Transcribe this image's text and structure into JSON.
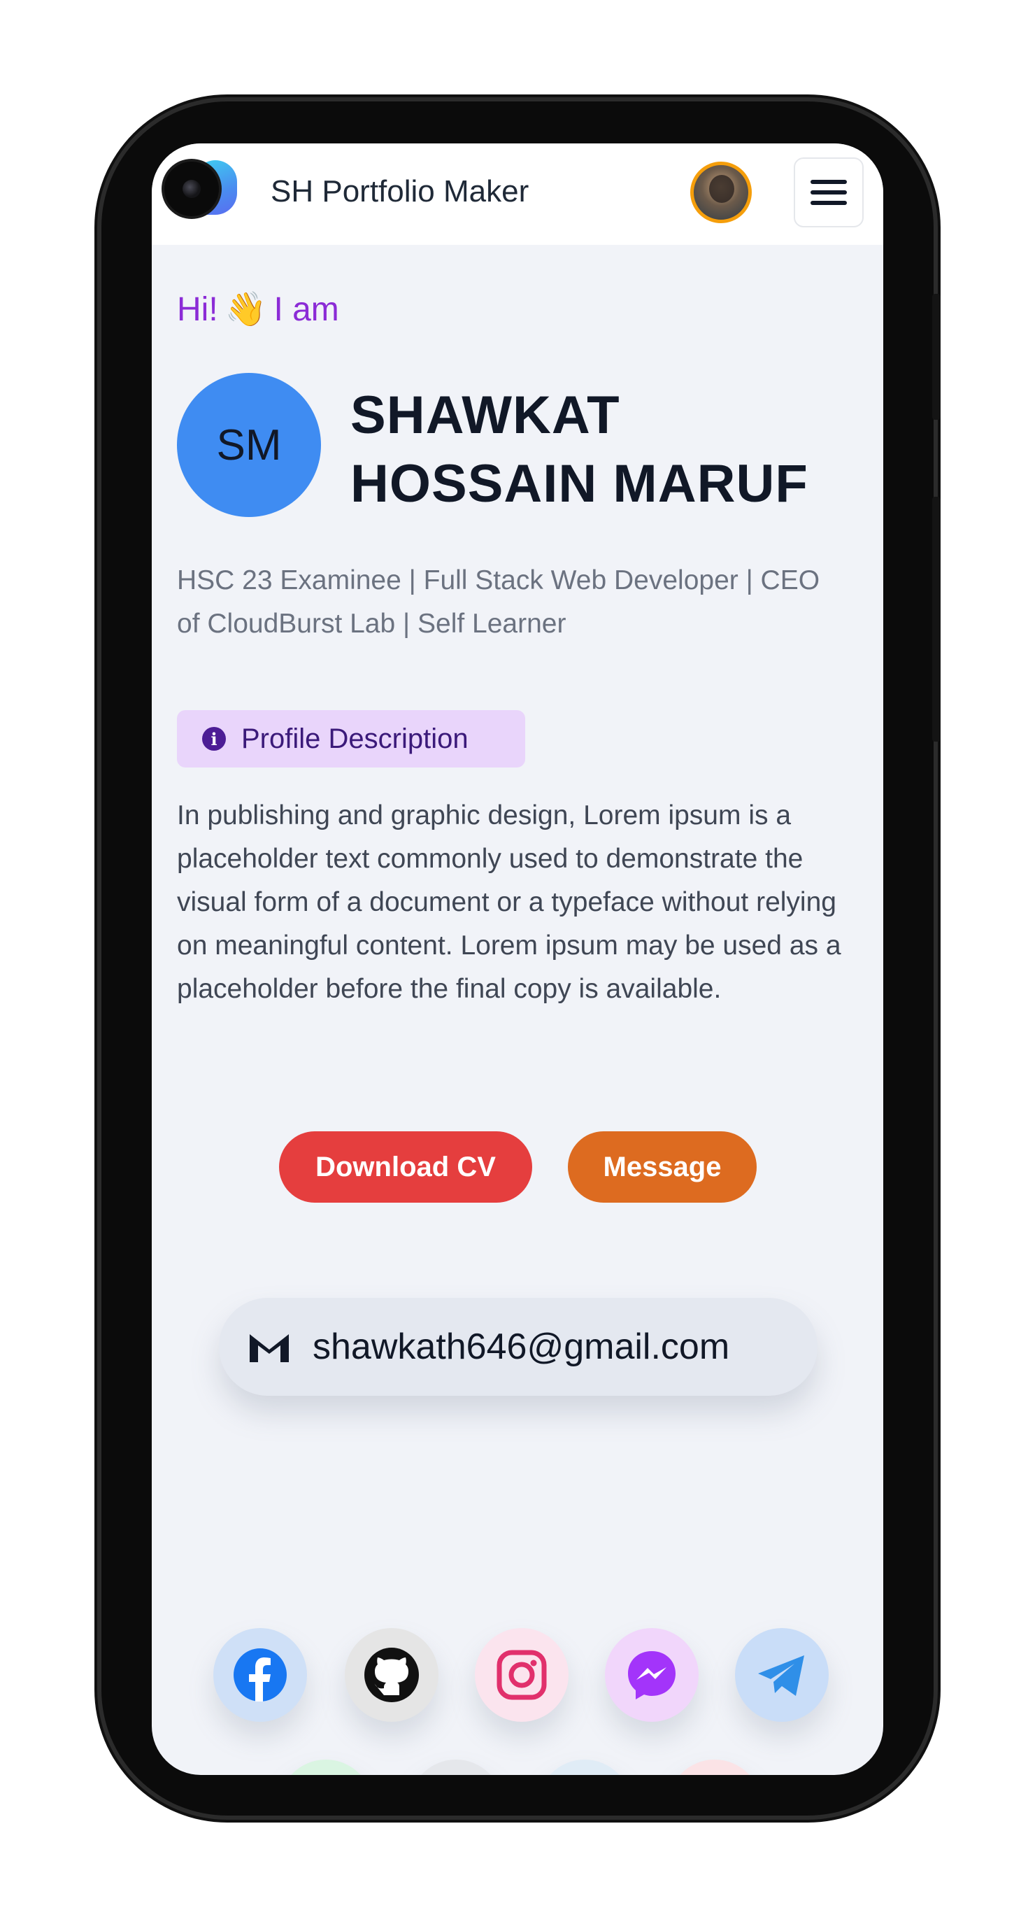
{
  "app": {
    "title": "SH Portfolio Maker"
  },
  "header": {
    "greeting_prefix": "Hi!",
    "wave": "👋",
    "greeting_suffix": "I am"
  },
  "profile": {
    "initials": "SM",
    "name_line1": "SHAWKAT",
    "name_line2": "HOSSAIN MARUF",
    "tagline": "HSC 23 Examinee | Full Stack Web Developer | CEO of CloudBurst Lab | Self Learner"
  },
  "description": {
    "badge_label": "Profile Description",
    "badge_icon": "i",
    "text": "In publishing and graphic design, Lorem ipsum is a placeholder text commonly used to demonstrate the visual form of a document or a typeface without relying on meaningful content. Lorem ipsum may be used as a placeholder before the final copy is available."
  },
  "actions": {
    "download_cv": "Download CV",
    "message": "Message"
  },
  "contact": {
    "email": "shawkath646@gmail.com",
    "email_icon": "gmail-icon"
  },
  "socials": [
    {
      "name": "facebook-icon",
      "color": "#1877f2",
      "bg": "#cfe0f7"
    },
    {
      "name": "github-icon",
      "color": "#111111",
      "bg": "#e5e5e5"
    },
    {
      "name": "instagram-icon",
      "color": "#e1306c",
      "bg": "#fbe4ee"
    },
    {
      "name": "messenger-icon",
      "color": "#a334fa",
      "bg": "#f1d6fb"
    },
    {
      "name": "telegram-icon",
      "color": "#2f8fe8",
      "bg": "#c9ddf8"
    },
    {
      "name": "whatsapp-icon",
      "color": "#25d366",
      "bg": "#daf5e2"
    },
    {
      "name": "website-icon",
      "color": "#5f6776",
      "bg": "#e5e7eb"
    },
    {
      "name": "linkedin-icon",
      "color": "#0a66c2",
      "bg": "#e0ecf6"
    },
    {
      "name": "youtube-icon",
      "color": "#e0243b",
      "bg": "#fbe3e6"
    }
  ],
  "colors": {
    "accent_purple": "#8b2bd6",
    "avatar_blue": "#3f8cf2",
    "download_red": "#e53e3e",
    "message_orange": "#dd6b20"
  }
}
